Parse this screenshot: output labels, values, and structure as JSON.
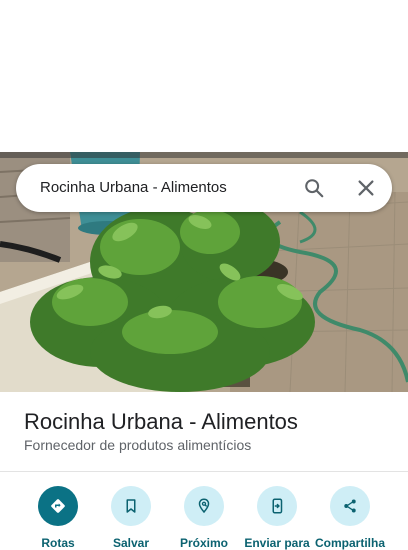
{
  "search": {
    "query": "Rocinha Urbana - Alimentos",
    "search_icon": "search-icon",
    "close_icon": "close-icon"
  },
  "photo": {
    "subject": "potted-plants-photo"
  },
  "place": {
    "name": "Rocinha Urbana - Alimentos",
    "category": "Fornecedor de produtos alimentícios"
  },
  "actions": [
    {
      "label": "Rotas",
      "icon": "directions-icon"
    },
    {
      "label": "Salvar",
      "icon": "bookmark-icon"
    },
    {
      "label": "Próximo",
      "icon": "nearby-icon"
    },
    {
      "label": "Enviar para",
      "icon": "send-to-phone-icon"
    },
    {
      "label": "Compartilha",
      "icon": "share-icon"
    }
  ],
  "colors": {
    "accent": "#0b7285",
    "accent_light": "#cfeef6",
    "label": "#0b6270"
  }
}
